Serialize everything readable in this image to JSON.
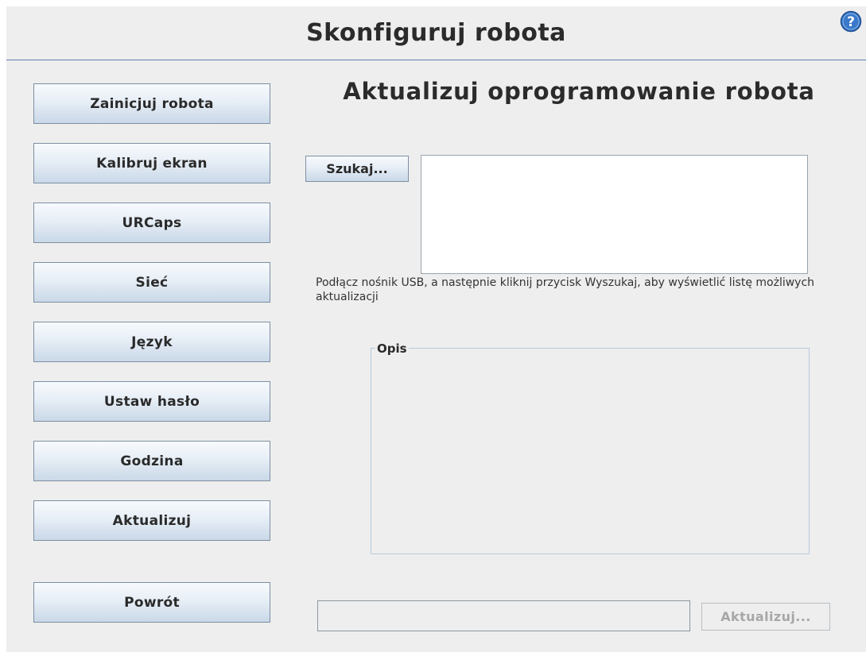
{
  "header": {
    "title": "Skonfiguruj robota"
  },
  "sidebar": {
    "items": [
      {
        "label": "Zainicjuj robota"
      },
      {
        "label": "Kalibruj ekran"
      },
      {
        "label": "URCaps"
      },
      {
        "label": "Sieć"
      },
      {
        "label": "Język"
      },
      {
        "label": "Ustaw hasło"
      },
      {
        "label": "Godzina"
      },
      {
        "label": "Aktualizuj"
      }
    ],
    "back_label": "Powrót"
  },
  "main": {
    "title": "Aktualizuj oprogramowanie robota",
    "search_label": "Szukaj...",
    "hint": "Podłącz nośnik USB, a następnie kliknij przycisk Wyszukaj, aby wyświetlić listę możliwych aktualizacji",
    "description_legend": "Opis",
    "update_label": "Aktualizuj..."
  },
  "icons": {
    "help": "help-icon"
  },
  "colors": {
    "accent": "#1f5fb0",
    "header_rule": "#5f7fa8",
    "button_gradient_top": "#f7fafd",
    "button_gradient_bottom": "#c9d8e8",
    "disabled_text": "#a7a7a7"
  }
}
